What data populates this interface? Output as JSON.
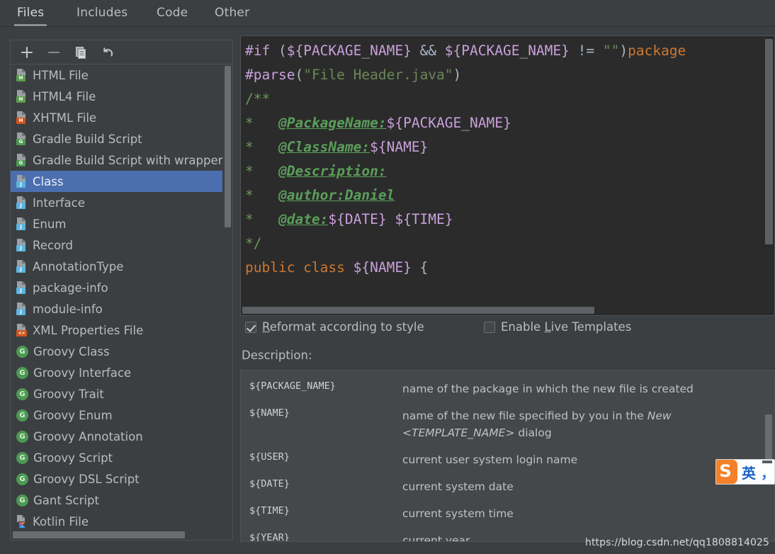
{
  "tabs": [
    {
      "label": "Files",
      "active": true
    },
    {
      "label": "Includes",
      "active": false
    },
    {
      "label": "Code",
      "active": false
    },
    {
      "label": "Other",
      "active": false
    }
  ],
  "toolbar": {
    "add_title": "Create Template",
    "remove_title": "Remove Template",
    "copy_title": "Copy Template",
    "reset_title": "Reset To Default"
  },
  "template_list": [
    {
      "label": "HTML File",
      "icon": "html-file-icon",
      "badge": "H",
      "badge_color": "#5a9e4e"
    },
    {
      "label": "HTML4 File",
      "icon": "html4-file-icon",
      "badge": "H",
      "badge_color": "#5a9e4e"
    },
    {
      "label": "XHTML File",
      "icon": "xhtml-file-icon",
      "badge": "H",
      "badge_color": "#d1551f"
    },
    {
      "label": "Gradle Build Script",
      "icon": "groovy-file-icon",
      "badge": "G",
      "badge_color": "#4c9a52"
    },
    {
      "label": "Gradle Build Script with wrapper",
      "icon": "groovy-file-icon",
      "badge": "G",
      "badge_color": "#4c9a52"
    },
    {
      "label": "Class",
      "icon": "java-class-icon",
      "badge": "J",
      "badge_color": "#5bb5e0",
      "selected": true
    },
    {
      "label": "Interface",
      "icon": "java-interface-icon",
      "badge": "J",
      "badge_color": "#5bb5e0"
    },
    {
      "label": "Enum",
      "icon": "java-enum-icon",
      "badge": "J",
      "badge_color": "#5bb5e0"
    },
    {
      "label": "Record",
      "icon": "java-record-icon",
      "badge": "J",
      "badge_color": "#5bb5e0"
    },
    {
      "label": "AnnotationType",
      "icon": "java-annotation-icon",
      "badge": "J",
      "badge_color": "#5bb5e0"
    },
    {
      "label": "package-info",
      "icon": "java-package-info-icon",
      "badge": "J",
      "badge_color": "#5bb5e0"
    },
    {
      "label": "module-info",
      "icon": "java-module-info-icon",
      "badge": "J",
      "badge_color": "#5bb5e0"
    },
    {
      "label": "XML Properties File",
      "icon": "xml-file-icon",
      "badge": "<>",
      "badge_color": "#d1551f"
    },
    {
      "label": "Groovy Class",
      "icon": "groovy-round-icon",
      "badge": "G",
      "badge_color": "#4c9a52"
    },
    {
      "label": "Groovy Interface",
      "icon": "groovy-round-icon",
      "badge": "G",
      "badge_color": "#4c9a52"
    },
    {
      "label": "Groovy Trait",
      "icon": "groovy-round-icon",
      "badge": "G",
      "badge_color": "#4c9a52"
    },
    {
      "label": "Groovy Enum",
      "icon": "groovy-round-icon",
      "badge": "G",
      "badge_color": "#4c9a52"
    },
    {
      "label": "Groovy Annotation",
      "icon": "groovy-round-icon",
      "badge": "G",
      "badge_color": "#4c9a52"
    },
    {
      "label": "Groovy Script",
      "icon": "groovy-round-icon",
      "badge": "G",
      "badge_color": "#4c9a52"
    },
    {
      "label": "Groovy DSL Script",
      "icon": "groovy-round-icon",
      "badge": "G",
      "badge_color": "#4c9a52"
    },
    {
      "label": "Gant Script",
      "icon": "groovy-round-icon",
      "badge": "G",
      "badge_color": "#4c9a52"
    },
    {
      "label": "Kotlin File",
      "icon": "kotlin-file-icon",
      "badge": "K",
      "badge_color": "#e8743b"
    }
  ],
  "editor": {
    "lines": [
      [
        {
          "t": "#if ",
          "c": "c-dir"
        },
        {
          "t": "(",
          "c": "c-paren"
        },
        {
          "t": "${PACKAGE_NAME}",
          "c": "c-var"
        },
        {
          "t": " && ",
          "c": "c-op"
        },
        {
          "t": "${PACKAGE_NAME}",
          "c": "c-var"
        },
        {
          "t": " != ",
          "c": "c-op"
        },
        {
          "t": "\"\"",
          "c": "c-str"
        },
        {
          "t": ")",
          "c": "c-paren"
        },
        {
          "t": "package",
          "c": "c-kw"
        }
      ],
      [
        {
          "t": "#parse",
          "c": "c-dir"
        },
        {
          "t": "(",
          "c": "c-paren"
        },
        {
          "t": "\"File Header.java\"",
          "c": "c-str"
        },
        {
          "t": ")",
          "c": "c-paren"
        }
      ],
      [
        {
          "t": "/**",
          "c": "c-cmt"
        }
      ],
      [
        {
          "t": "*   ",
          "c": "c-cmt"
        },
        {
          "t": "@PackageName:",
          "c": "c-tag"
        },
        {
          "t": "${PACKAGE_NAME}",
          "c": "c-var"
        }
      ],
      [
        {
          "t": "*   ",
          "c": "c-cmt"
        },
        {
          "t": "@ClassName:",
          "c": "c-tag"
        },
        {
          "t": "${NAME}",
          "c": "c-var"
        }
      ],
      [
        {
          "t": "*   ",
          "c": "c-cmt"
        },
        {
          "t": "@Description:",
          "c": "c-tag"
        }
      ],
      [
        {
          "t": "*   ",
          "c": "c-cmt"
        },
        {
          "t": "@author:",
          "c": "c-tag"
        },
        {
          "t": "Daniel",
          "c": "c-tagv"
        }
      ],
      [
        {
          "t": "*   ",
          "c": "c-cmt"
        },
        {
          "t": "@date:",
          "c": "c-tag"
        },
        {
          "t": "${DATE} ${TIME}",
          "c": "c-var"
        }
      ],
      [
        {
          "t": "*/",
          "c": "c-cmt"
        }
      ],
      [
        {
          "t": "public class ",
          "c": "c-kw"
        },
        {
          "t": "${NAME}",
          "c": "c-var"
        },
        {
          "t": " {",
          "c": "c-brace"
        }
      ]
    ]
  },
  "options": {
    "reformat": {
      "label_pre": "",
      "label_underlined": "R",
      "label_post": "eformat according to style",
      "checked": true
    },
    "live_templates": {
      "label_pre": "Enable ",
      "label_underlined": "L",
      "label_post": "ive Templates",
      "checked": false
    }
  },
  "description": {
    "label": "Description:",
    "rows": [
      {
        "var": "${PACKAGE_NAME}",
        "desc_pre": "name of the package in which the new file is created",
        "em1": "",
        "desc_mid": "",
        "em2": "",
        "desc_post": ""
      },
      {
        "var": "${NAME}",
        "desc_pre": "name of the new file specified by you in the ",
        "em1": "New",
        "desc_mid": " ",
        "em2": "<TEMPLATE_NAME>",
        "desc_post": " dialog"
      },
      {
        "var": "${USER}",
        "desc_pre": "current user system login name",
        "em1": "",
        "desc_mid": "",
        "em2": "",
        "desc_post": ""
      },
      {
        "var": "${DATE}",
        "desc_pre": "current system date",
        "em1": "",
        "desc_mid": "",
        "em2": "",
        "desc_post": ""
      },
      {
        "var": "${TIME}",
        "desc_pre": "current system time",
        "em1": "",
        "desc_mid": "",
        "em2": "",
        "desc_post": ""
      },
      {
        "var": "${YEAR}",
        "desc_pre": "current year",
        "em1": "",
        "desc_mid": "",
        "em2": "",
        "desc_post": ""
      }
    ]
  },
  "watermark": {
    "url": "https://blog.csdn.net/qq1808814025"
  },
  "ime": {
    "logo": "S",
    "mode": "英",
    "punct": "，"
  },
  "colors": {
    "background": "#3c3f41",
    "editor_background": "#2b2b2b",
    "selection": "#4b6eaf",
    "text": "#bbbbbb",
    "keyword": "#cc7832",
    "variable": "#c9a0dc",
    "string": "#6a8759",
    "comment": "#6a9955",
    "javadoc_tag": "#5a9e5a"
  }
}
